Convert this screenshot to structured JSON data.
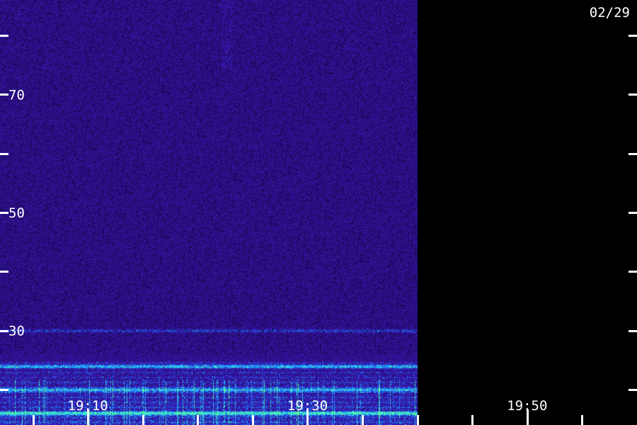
{
  "date_label": "02/29",
  "chart_data": {
    "type": "heatmap",
    "title": "",
    "xlabel": "",
    "ylabel": "",
    "x_tick_labels": [
      "19:10",
      "19:30",
      "19:50"
    ],
    "y_tick_labels": [
      "30",
      "50",
      "70"
    ],
    "x_range": [
      "19:02",
      "20:00"
    ],
    "y_range": [
      14,
      86
    ],
    "y_major_ticks": [
      20,
      30,
      40,
      50,
      60,
      70,
      80
    ],
    "x_minor_ticks_minutes": [
      5,
      10,
      15,
      20,
      25,
      30,
      35,
      40,
      45,
      50,
      55
    ],
    "data_end_time": "19:40",
    "grid": false,
    "legend": "none",
    "colors": {
      "background": "#000000",
      "noise_low": "#2a0870",
      "noise_high": "#4a1ea8",
      "band_blue": "#2050ff",
      "band_cyan": "#20d0ff",
      "band_green": "#40ff90",
      "axis": "#ffffff"
    },
    "bands": [
      {
        "y": 30,
        "intensity": "medium"
      },
      {
        "y": 24,
        "intensity": "high"
      },
      {
        "y": 20,
        "intensity": "high"
      },
      {
        "y": 16,
        "intensity": "very high"
      }
    ]
  }
}
